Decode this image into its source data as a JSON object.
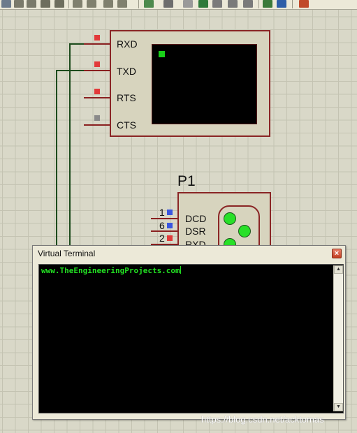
{
  "toolbar": {
    "icons": [
      "search-icon",
      "wire-icon",
      "pointer-icon",
      "arrow-icon",
      "probe-icon",
      "netlist-icon",
      "binoculars-icon",
      "wire-label-icon",
      "a-label-icon",
      "chart-icon",
      "sheet-icon",
      "cut-icon",
      "property-icon",
      "pin-icon",
      "dollar-icon",
      "lightning-icon",
      "bom-icon"
    ]
  },
  "virtual_terminal_component": {
    "pins": [
      "RXD",
      "TXD",
      "RTS",
      "CTS"
    ],
    "pin_colors": [
      "#e23a3a",
      "#e23a3a",
      "#e23a3a",
      "#8a8a8a"
    ],
    "cursor_color": "#19d019"
  },
  "p1": {
    "label": "P1",
    "pins": [
      {
        "num": "1",
        "name": "DCD",
        "color": "#3a56e0"
      },
      {
        "num": "6",
        "name": "DSR",
        "color": "#3a56e0"
      },
      {
        "num": "2",
        "name": "RXD",
        "color": "#e23a3a"
      }
    ]
  },
  "dialog": {
    "title": "Virtual Terminal",
    "close_label": "×",
    "output": "www.TheEngineeringProjects.com"
  },
  "watermark": "https://blog.csdn.net/acktomas"
}
